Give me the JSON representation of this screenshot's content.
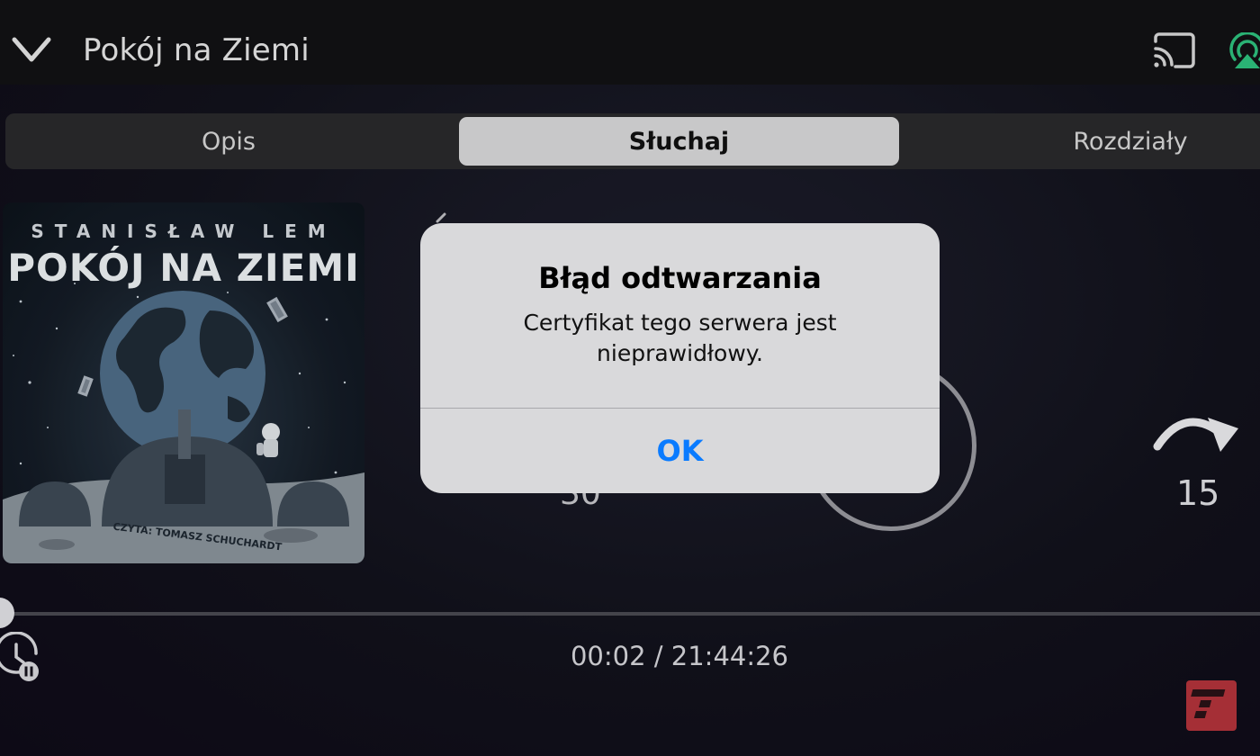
{
  "header": {
    "title": "Pokój na Ziemi"
  },
  "tabs": [
    {
      "label": "Opis",
      "selected": false
    },
    {
      "label": "Słuchaj",
      "selected": true
    },
    {
      "label": "Rozdziały",
      "selected": false
    }
  ],
  "cover": {
    "author": "STANISŁAW LEM",
    "title": "POKÓJ NA ZIEMI",
    "narrator": "CZYTA: TOMASZ SCHUCHARDT"
  },
  "player": {
    "rewind_seconds": "30",
    "forward_seconds": "15",
    "elapsed": "00:02",
    "separator": " / ",
    "total": "21:44:26",
    "progress_fraction": 0.0
  },
  "dialog": {
    "title": "Błąd odtwarzania",
    "message": "Certyfikat tego serwera jest nieprawidłowy.",
    "ok_label": "OK"
  },
  "colors": {
    "accent_blue": "#0a7bff",
    "airplay_green": "#2ec27e",
    "brand_red": "#b3333b"
  },
  "icons": [
    "chevron-down-icon",
    "cast-icon",
    "airplay-icon",
    "forward-15-icon",
    "sleep-timer-icon",
    "brand-logo-icon"
  ]
}
